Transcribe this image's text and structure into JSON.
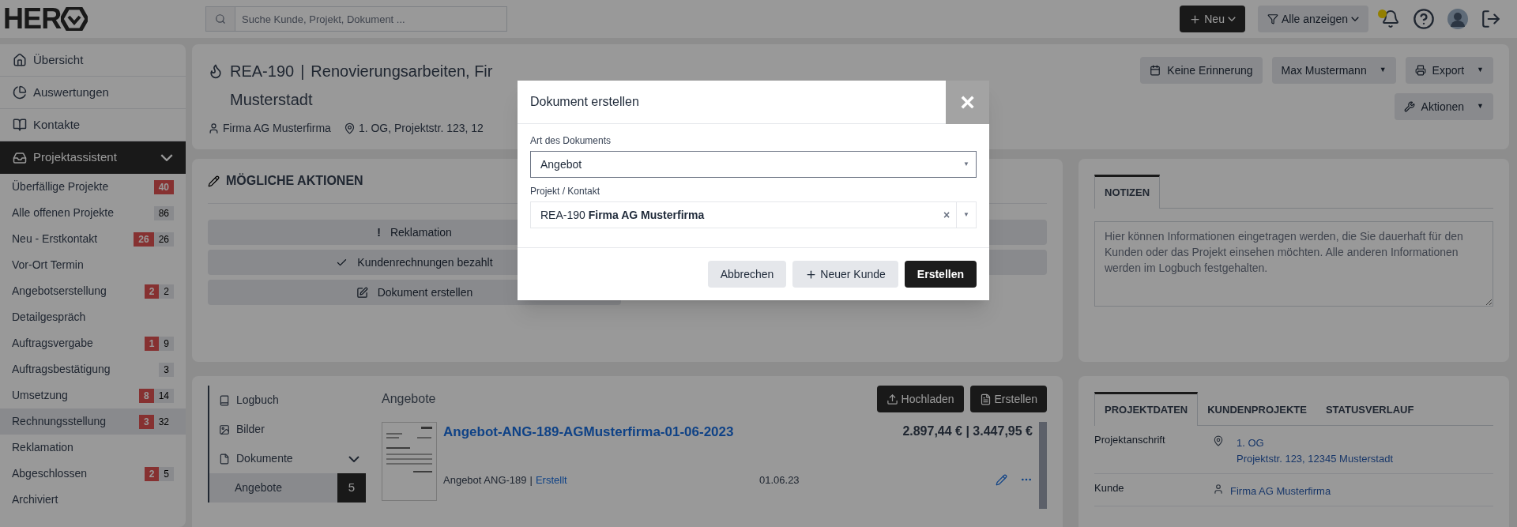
{
  "topbar": {
    "logo": "HER",
    "search": {
      "placeholder": "Suche Kunde, Projekt, Dokument ..."
    },
    "new_button": "Neu",
    "filter_button": "Alle anzeigen",
    "notification_dot": true
  },
  "sidebar": {
    "items": [
      {
        "label": "Übersicht"
      },
      {
        "label": "Auswertungen"
      },
      {
        "label": "Kontakte"
      }
    ],
    "group": {
      "label": "Projektassistent",
      "expanded": true,
      "children": [
        {
          "label": "Überfällige Projekte",
          "overdue": "40",
          "selected": false
        },
        {
          "label": "Alle offenen Projekte",
          "count": "86",
          "selected": false
        },
        {
          "label": "Neu - Erstkontakt",
          "overdue": "26",
          "count": "26",
          "selected": false
        },
        {
          "label": "Vor-Ort Termin",
          "selected": false
        },
        {
          "label": "Angebotserstellung",
          "overdue": "2",
          "count": "2",
          "selected": false
        },
        {
          "label": "Detailgespräch",
          "selected": false
        },
        {
          "label": "Auftragsvergabe",
          "overdue": "1",
          "count": "9",
          "selected": false
        },
        {
          "label": "Auftragsbestätigung",
          "count": "3",
          "selected": false
        },
        {
          "label": "Umsetzung",
          "overdue": "8",
          "count": "14",
          "selected": false
        },
        {
          "label": "Rechnungsstellung",
          "overdue": "3",
          "count": "32",
          "selected": true
        },
        {
          "label": "Reklamation",
          "selected": false
        },
        {
          "label": "Abgeschlossen",
          "overdue": "2",
          "count": "5",
          "selected": false
        },
        {
          "label": "Archiviert",
          "selected": false
        }
      ]
    }
  },
  "project": {
    "number": "REA-190",
    "separator": "|",
    "title_lines": [
      "Renovierungsarbeiten, Fir",
      "Musterstadt"
    ],
    "customer": "Firma AG Musterfirma",
    "address": "1. OG, Projektstr. 123, 12",
    "buttons": [
      {
        "label": "Keine Erinnerung",
        "kind": "calendar"
      },
      {
        "label": "Max Mustermann",
        "kind": "menu",
        "caret": "▼"
      },
      {
        "label": "Export",
        "kind": "print",
        "caret": "▼"
      },
      {
        "label": "Aktionen",
        "kind": "tools",
        "caret": "▼"
      }
    ]
  },
  "actions": {
    "title": "MÖGLICHE AKTIONEN",
    "items": [
      {
        "label": "Reklamation",
        "kind": "warning",
        "icon": "!"
      },
      {
        "label": "Kundenrechnungen bezahlt",
        "kind": "check"
      },
      {
        "label": "Dokument erstellen",
        "kind": "edit"
      }
    ]
  },
  "notes": {
    "tab": "NOTIZEN",
    "placeholder": "Hier können Informationen eingetragen werden, die Sie dauerhaft für den Kunden oder das Projekt einsehen möchten. Alle anderen Informationen werden im Logbuch festgehalten."
  },
  "documents": {
    "nav": [
      {
        "label": "Logbuch",
        "selected": false
      },
      {
        "label": "Bilder",
        "selected": false
      },
      {
        "label": "Dokumente",
        "selected": false,
        "expanded": true
      },
      {
        "label": "Angebote",
        "selected": true,
        "count": "5"
      }
    ],
    "heading": "Angebote",
    "buttons": [
      "Hochladen",
      "Erstellen"
    ],
    "rows": [
      {
        "title": "Angebot-ANG-189-AGMusterfirma-01-06-2023",
        "amounts": "2.897,44 € | 3.447,95 €",
        "number": "Angebot ANG-189",
        "separator": "|",
        "status": "Erstellt",
        "date": "01.06.23"
      }
    ]
  },
  "project_data": {
    "tabs": [
      {
        "label": "PROJEKTDATEN",
        "selected": true
      },
      {
        "label": "KUNDENPROJEKTE",
        "selected": false
      },
      {
        "label": "STATUSVERLAUF",
        "selected": false
      }
    ],
    "rows": [
      {
        "label": "Projektanschrift",
        "kind": "address",
        "lines": [
          "1. OG",
          "Projektstr. 123, 12345 Musterstadt"
        ]
      },
      {
        "label": "Kunde",
        "kind": "person",
        "lines": [
          "Firma AG Musterfirma"
        ]
      }
    ]
  },
  "dialog": {
    "title": "Dokument erstellen",
    "close": "×",
    "fields": [
      {
        "label": "Art des Dokuments",
        "value": "Angebot",
        "caret": "▼",
        "clearable": false
      },
      {
        "label": "Projekt / Kontakt",
        "value": "REA-190 **Firma AG Musterfirma**",
        "caret": "▼",
        "clearable": true,
        "clear": "×"
      }
    ],
    "buttons": [
      {
        "label": "Abbrechen",
        "kind": "secondary"
      },
      {
        "label": "Neuer Kunde",
        "kind": "add"
      },
      {
        "label": "Erstellen",
        "kind": "primary"
      }
    ]
  }
}
